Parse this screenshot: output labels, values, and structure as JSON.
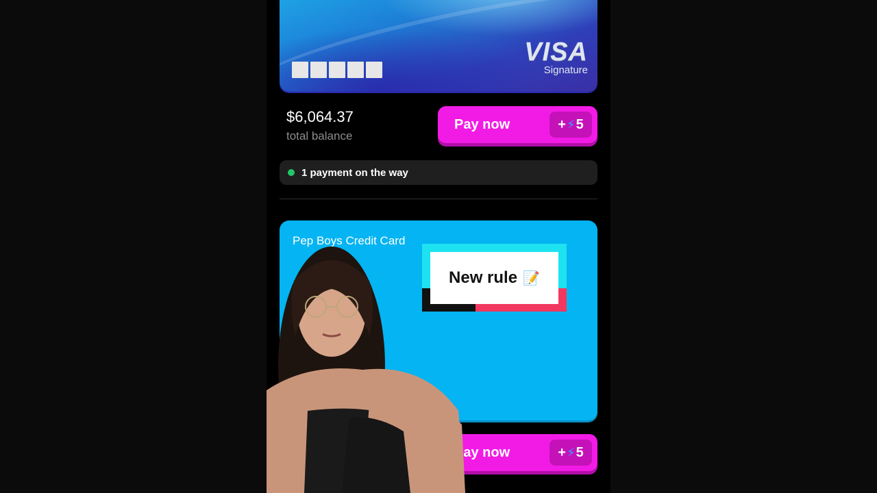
{
  "visa_card": {
    "brand": "VISA",
    "tier": "Signature"
  },
  "account1": {
    "balance": "$6,064.37",
    "balance_label": "total balance",
    "pay_label": "Pay now",
    "bonus_prefix": "+",
    "bonus_value": "5",
    "status": "1 payment on the way"
  },
  "account2": {
    "card_name": "Pep Boys Credit Card",
    "pay_label": "Pay now",
    "bonus_prefix": "+",
    "bonus_value": "5"
  },
  "overlay": {
    "caption": "New rule"
  },
  "colors": {
    "pay_button": "#f21be6",
    "pep_card": "#05b4f2",
    "status_dot": "#22c76a"
  }
}
